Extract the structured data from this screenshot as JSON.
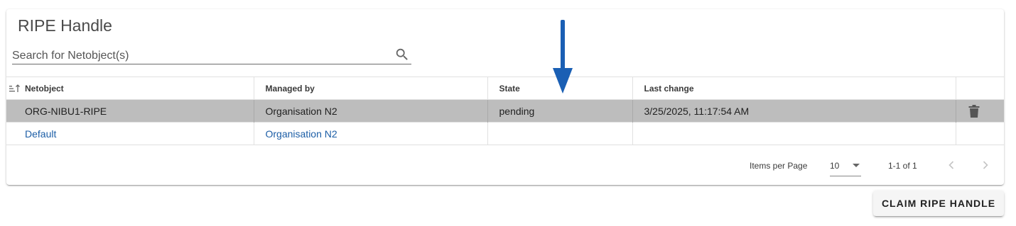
{
  "card": {
    "title": "RIPE Handle",
    "search_placeholder": "Search for Netobject(s)"
  },
  "table": {
    "columns": [
      "Netobject",
      "Managed by",
      "State",
      "Last change"
    ],
    "rows": [
      {
        "netobject": "ORG-NIBU1-RIPE",
        "managed_by": "Organisation N2",
        "state": "pending",
        "last_change": "3/25/2025, 11:17:54 AM",
        "selected": true,
        "actions": "delete-icon"
      },
      {
        "netobject": "Default",
        "managed_by": "Organisation N2",
        "state": "",
        "last_change": "",
        "selected": false
      }
    ]
  },
  "paginator": {
    "items_per_page_label": "Items per Page",
    "items_per_page_value": "10",
    "range_label": "1-1 of 1"
  },
  "claim_button": "CLAIM RIPE HANDLE",
  "colors": {
    "link": "#1c5ea6",
    "selected_row": "#bdbdbd",
    "annotation_arrow": "#1a5fb4"
  },
  "icons": [
    "search-icon",
    "sort-icon",
    "delete-icon",
    "chevron-left-icon",
    "chevron-right-icon",
    "dropdown-caret-icon",
    "annotation-arrow"
  ]
}
